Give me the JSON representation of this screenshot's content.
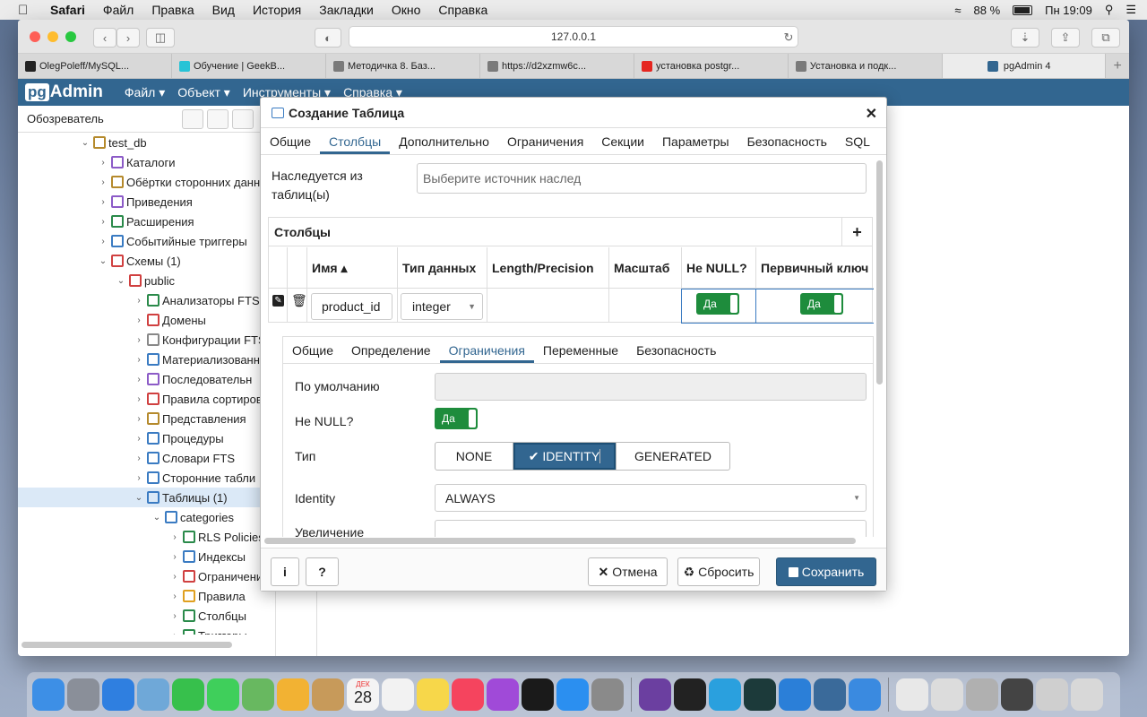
{
  "menubar": {
    "app": "Safari",
    "items": [
      "Файл",
      "Правка",
      "Вид",
      "История",
      "Закладки",
      "Окно",
      "Справка"
    ],
    "battery": "88 %",
    "clock": "Пн 19:09"
  },
  "browser": {
    "url": "127.0.0.1",
    "tabs": [
      {
        "title": "OlegPoleff/MySQL...",
        "color": "#222222"
      },
      {
        "title": "Обучение | GeekB...",
        "color": "#27c3d6"
      },
      {
        "title": "Методичка 8. Баз...",
        "color": "#7a7a7a"
      },
      {
        "title": "https://d2xzmw6c...",
        "color": "#7a7a7a"
      },
      {
        "title": "установка postgr...",
        "color": "#e52620"
      },
      {
        "title": "Установка и подк...",
        "color": "#7a7a7a"
      },
      {
        "title": "pgAdmin 4",
        "color": "#326690"
      }
    ]
  },
  "pgadmin": {
    "logo": "Admin",
    "logo_prefix": "pg",
    "menu": [
      "Файл",
      "Объект",
      "Инструменты",
      "Справка"
    ],
    "browser_title": "Обозреватель",
    "tree": [
      {
        "label": "test_db",
        "chev": "⌄",
        "indent": 0,
        "color": "#b58a2c"
      },
      {
        "label": "Каталоги",
        "chev": "›",
        "indent": 1,
        "color": "#8c5bc7"
      },
      {
        "label": "Обёртки сторонних данн",
        "chev": "›",
        "indent": 1,
        "color": "#b58a2c"
      },
      {
        "label": "Приведения",
        "chev": "›",
        "indent": 1,
        "color": "#8c5bc7"
      },
      {
        "label": "Расширения",
        "chev": "›",
        "indent": 1,
        "color": "#2a8a4a"
      },
      {
        "label": "Событийные триггеры",
        "chev": "›",
        "indent": 1,
        "color": "#3a7bc2"
      },
      {
        "label": "Схемы (1)",
        "chev": "⌄",
        "indent": 1,
        "color": "#d04040"
      },
      {
        "label": "public",
        "chev": "⌄",
        "indent": 2,
        "color": "#d04040"
      },
      {
        "label": "Анализаторы FTS",
        "chev": "›",
        "indent": 3,
        "color": "#2a8a4a"
      },
      {
        "label": "Домены",
        "chev": "›",
        "indent": 3,
        "color": "#d04040"
      },
      {
        "label": "Конфигурации FTS",
        "chev": "›",
        "indent": 3,
        "color": "#888888"
      },
      {
        "label": "Материализованн",
        "chev": "›",
        "indent": 3,
        "color": "#3a7bc2"
      },
      {
        "label": "Последовательн",
        "chev": "›",
        "indent": 3,
        "color": "#8c5bc7"
      },
      {
        "label": "Правила сортиров",
        "chev": "›",
        "indent": 3,
        "color": "#d04040"
      },
      {
        "label": "Представления",
        "chev": "›",
        "indent": 3,
        "color": "#b58a2c"
      },
      {
        "label": "Процедуры",
        "chev": "›",
        "indent": 3,
        "color": "#3a7bc2"
      },
      {
        "label": "Словари FTS",
        "chev": "›",
        "indent": 3,
        "color": "#3a7bc2"
      },
      {
        "label": "Сторонние табли",
        "chev": "›",
        "indent": 3,
        "color": "#3a7bc2"
      },
      {
        "label": "Таблицы (1)",
        "chev": "⌄",
        "indent": 3,
        "color": "#3a7bc2",
        "selected": true
      },
      {
        "label": "categories",
        "chev": "⌄",
        "indent": 4,
        "color": "#3a7bc2"
      },
      {
        "label": "RLS Policies",
        "chev": "›",
        "indent": 5,
        "color": "#2a8a4a"
      },
      {
        "label": "Индексы",
        "chev": "›",
        "indent": 5,
        "color": "#3a7bc2"
      },
      {
        "label": "Ограничения",
        "chev": "›",
        "indent": 5,
        "color": "#d04040"
      },
      {
        "label": "Правила",
        "chev": "›",
        "indent": 5,
        "color": "#e0a020"
      },
      {
        "label": "Столбцы",
        "chev": "›",
        "indent": 5,
        "color": "#2a8a4a"
      },
      {
        "label": "Триггеры",
        "chev": "›",
        "indent": 5,
        "color": "#2a8a4a"
      }
    ]
  },
  "dialog": {
    "title": "Создание Таблица",
    "tabs": [
      "Общие",
      "Столбцы",
      "Дополнительно",
      "Ограничения",
      "Секции",
      "Параметры",
      "Безопасность",
      "SQL"
    ],
    "active_tab": 1,
    "inherit_label_line1": "Наследуется из",
    "inherit_label_line2": "таблиц(ы)",
    "inherit_placeholder": "Выберите источник наслед",
    "columns_title": "Столбцы",
    "columns_add": "+",
    "col_headers": [
      "Имя ▴",
      "Тип данных",
      "Length/Precision",
      "Масштаб",
      "Не NULL?",
      "Первичный ключ"
    ],
    "row": {
      "name": "product_id",
      "type": "integer",
      "not_null": "Да",
      "pk": "Да"
    },
    "subtabs": [
      "Общие",
      "Определение",
      "Ограничения",
      "Переменные",
      "Безопасность"
    ],
    "active_subtab": 2,
    "fields": {
      "default_label": "По умолчанию",
      "notnull_label": "Не NULL?",
      "notnull_value": "Да",
      "type_label": "Тип",
      "type_options": [
        "NONE",
        "IDENTITY",
        "GENERATED"
      ],
      "type_selected": "IDENTITY",
      "identity_label": "Identity",
      "identity_value": "ALWAYS",
      "increment_label": "Увеличение"
    },
    "footer": {
      "info": "i",
      "help": "?",
      "cancel": "Отмена",
      "reset": "Сбросить",
      "save": "Сохранить"
    }
  },
  "dock": {
    "apps": [
      {
        "name": "finder",
        "color": "#3d8fe6"
      },
      {
        "name": "launchpad",
        "color": "#8a8f99"
      },
      {
        "name": "safari",
        "color": "#2f7fe0"
      },
      {
        "name": "mail",
        "color": "#6fa8d8"
      },
      {
        "name": "facetime",
        "color": "#37c04c"
      },
      {
        "name": "messages",
        "color": "#3fcf5b"
      },
      {
        "name": "maps",
        "color": "#68b860"
      },
      {
        "name": "photos",
        "color": "#f2b233"
      },
      {
        "name": "contacts",
        "color": "#c79a5a"
      },
      {
        "name": "calendar",
        "color": "#f4f4f4"
      },
      {
        "name": "reminders",
        "color": "#f2f2f2"
      },
      {
        "name": "notes",
        "color": "#f7d74a"
      },
      {
        "name": "music",
        "color": "#f5445e"
      },
      {
        "name": "podcasts",
        "color": "#a04ad8"
      },
      {
        "name": "tv",
        "color": "#1a1a1a"
      },
      {
        "name": "app-store",
        "color": "#2b8ff0"
      },
      {
        "name": "system-preferences",
        "color": "#8a8a8a"
      },
      {
        "name": "github",
        "color": "#6b3fa0"
      },
      {
        "name": "terminal",
        "color": "#222222"
      },
      {
        "name": "telegram",
        "color": "#2aa0de"
      },
      {
        "name": "gitkraken",
        "color": "#1c3a3a"
      },
      {
        "name": "vscode",
        "color": "#2b7fd8"
      },
      {
        "name": "mysql-workbench",
        "color": "#3a6a9a"
      },
      {
        "name": "xcode",
        "color": "#3a8ae0"
      },
      {
        "name": "doc",
        "color": "#e8e8e8"
      },
      {
        "name": "preview",
        "color": "#dcdcdc"
      },
      {
        "name": "screenshot",
        "color": "#b0b0b0"
      },
      {
        "name": "window1",
        "color": "#444444"
      },
      {
        "name": "window2",
        "color": "#cfcfcf"
      },
      {
        "name": "trash",
        "color": "#d8d8d8"
      }
    ],
    "calendar_day": "28",
    "calendar_month": "ДЕК"
  }
}
